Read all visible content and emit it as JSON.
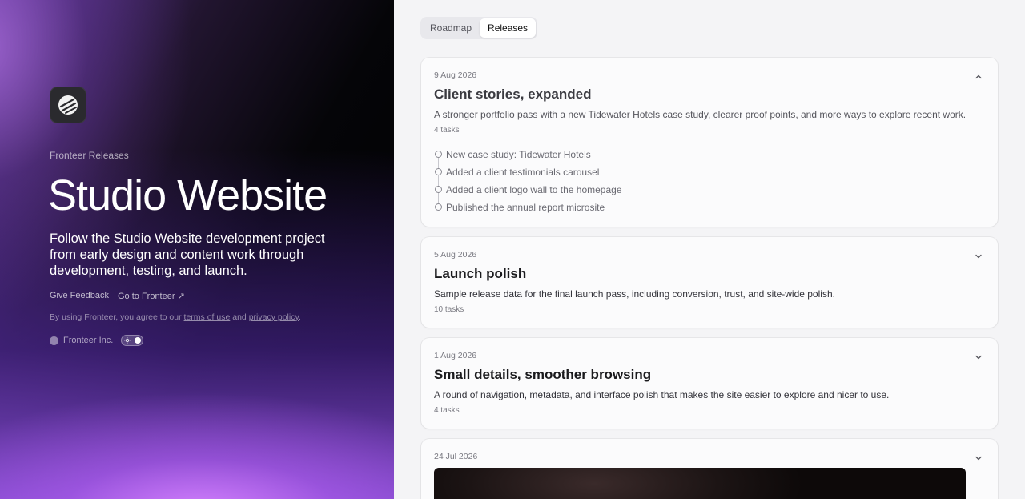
{
  "hero": {
    "eyebrow": "Fronteer Releases",
    "title": "Studio Website",
    "subtitle": "Follow the Studio Website development project from early design and content work through development, testing, and launch.",
    "links": {
      "feedback": "Give Feedback",
      "go_to": "Go to Fronteer ↗"
    },
    "legal": {
      "prefix": "By using Fronteer, you agree to our",
      "terms": "terms of use",
      "and": "and",
      "privacy": "privacy policy",
      "suffix": "."
    },
    "company": "Fronteer Inc."
  },
  "tabs": [
    {
      "label": "Roadmap",
      "active": false
    },
    {
      "label": "Releases",
      "active": true
    }
  ],
  "releases": [
    {
      "date": "9 Aug 2026",
      "title": "Client stories, expanded",
      "description": "A stronger portfolio pass with a new Tidewater Hotels case study, clearer proof points, and more ways to explore recent work.",
      "count": "4 tasks",
      "expanded": true,
      "tasks": [
        "New case study: Tidewater Hotels",
        "Added a client testimonials carousel",
        "Added a client logo wall to the homepage",
        "Published the annual report microsite"
      ]
    },
    {
      "date": "5 Aug 2026",
      "title": "Launch polish",
      "description": "Sample release data for the final launch pass, including conversion, trust, and site-wide polish.",
      "count": "10 tasks",
      "expanded": false
    },
    {
      "date": "1 Aug 2026",
      "title": "Small details, smoother browsing",
      "description": "A round of navigation, metadata, and interface polish that makes the site easier to explore and nicer to use.",
      "count": "4 tasks",
      "expanded": false
    },
    {
      "date": "24 Jul 2026",
      "expanded": false
    }
  ],
  "icons": {
    "logo": "fronteer-logo-icon",
    "collapse": "chevron-up-icon",
    "expand": "chevron-down-icon",
    "theme": "sun-icon"
  }
}
